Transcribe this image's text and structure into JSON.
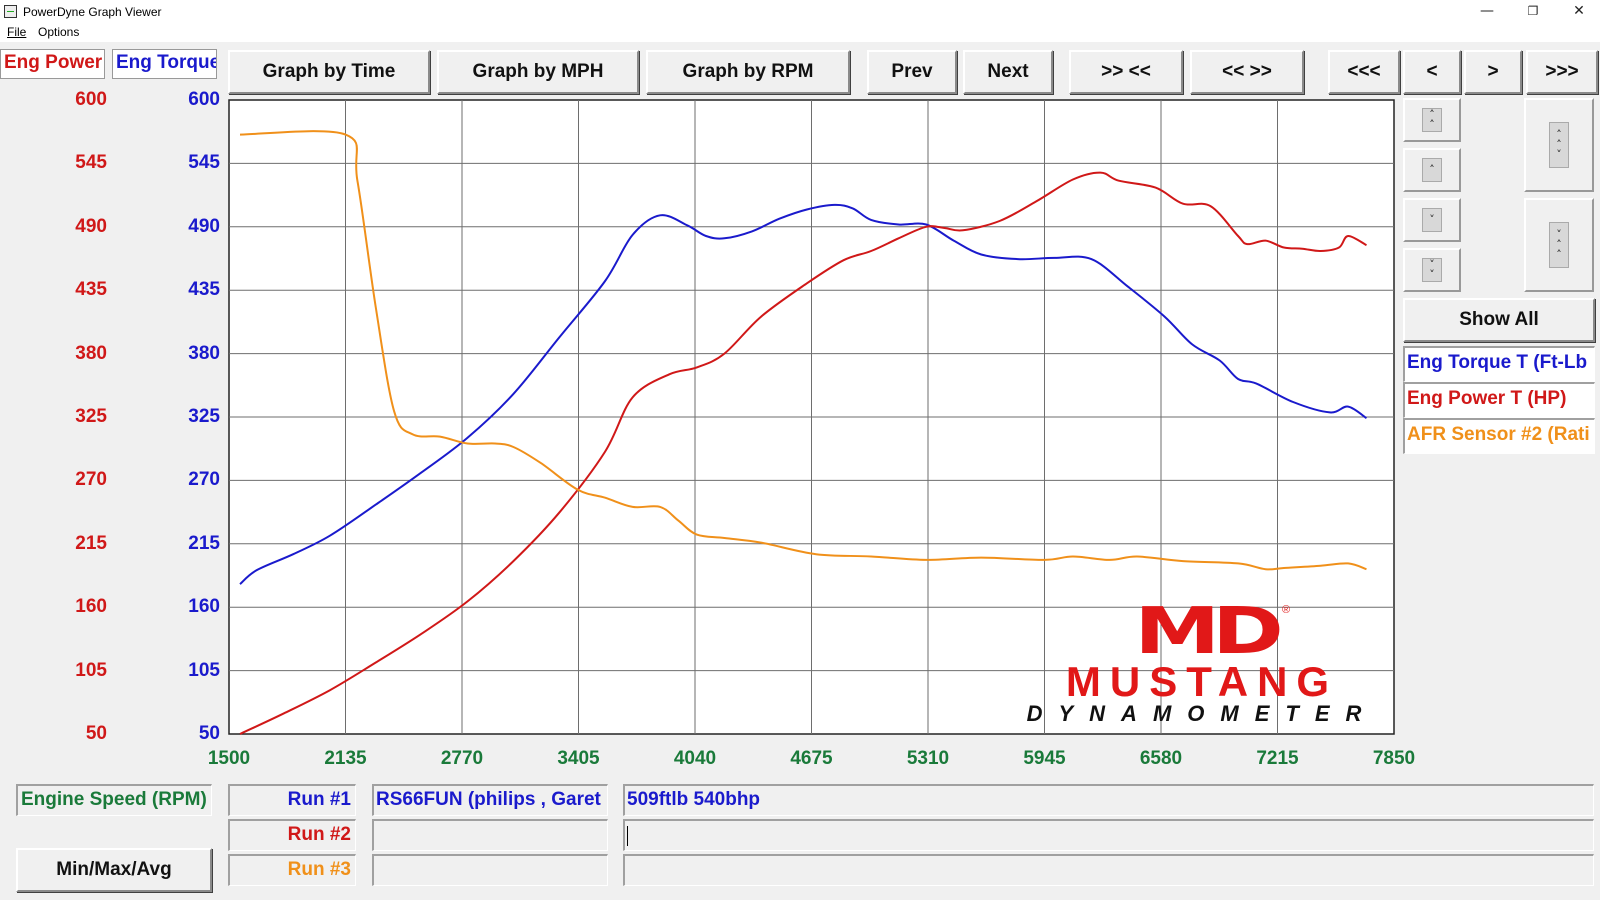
{
  "window": {
    "title": "PowerDyne Graph Viewer",
    "menu": [
      "File",
      "Options"
    ]
  },
  "toolbar": {
    "graph_by_time": "Graph by Time",
    "graph_by_mph": "Graph by MPH",
    "graph_by_rpm": "Graph by RPM",
    "prev": "Prev",
    "next": "Next",
    "zoom_in": ">> <<",
    "zoom_out": "<< >>",
    "first": "<<<",
    "back": "<",
    "forward": ">",
    "last": ">>>"
  },
  "axes": {
    "left1_label": "Eng Power",
    "left2_label": "Eng Torque",
    "x_label": "Engine Speed (RPM)"
  },
  "side": {
    "show_all": "Show All",
    "legend": [
      {
        "label": "Eng Torque T (Ft-Lb",
        "color": "#1a1acc"
      },
      {
        "label": "Eng Power T (HP)",
        "color": "#d01818"
      },
      {
        "label": "AFR Sensor #2 (Rati",
        "color": "#f0901a"
      }
    ]
  },
  "bottom": {
    "min_max_avg": "Min/Max/Avg",
    "runs": [
      {
        "label": "Run #1",
        "color": "#1a1acc",
        "name": "RS66FUN  (philips , Garet",
        "note": "509ftlb 540bhp"
      },
      {
        "label": "Run #2",
        "color": "#d01818",
        "name": "",
        "note": ""
      },
      {
        "label": "Run #3",
        "color": "#f0901a",
        "name": "",
        "note": ""
      }
    ]
  },
  "logo": {
    "mark": "MD",
    "line1": "MUSTANG",
    "line2": "DYNAMOMETER",
    "registered": "®"
  },
  "chart_data": {
    "type": "line",
    "xlabel": "Engine Speed (RPM)",
    "x_ticks": [
      1500,
      2135,
      2770,
      3405,
      4040,
      4675,
      5310,
      5945,
      6580,
      7215,
      7850
    ],
    "y_ticks": [
      600,
      545,
      490,
      435,
      380,
      325,
      270,
      215,
      160,
      105,
      50
    ],
    "xlim": [
      1500,
      7850
    ],
    "ylim": [
      50,
      600
    ],
    "grid": true,
    "series": [
      {
        "name": "Eng Torque T (Ft-Lb",
        "color": "#1a1acc",
        "x": [
          1560,
          1650,
          1850,
          2050,
          2300,
          2550,
          2800,
          3050,
          3300,
          3550,
          3700,
          3850,
          4000,
          4100,
          4200,
          4350,
          4500,
          4650,
          4800,
          4900,
          5000,
          5150,
          5300,
          5450,
          5600,
          5800,
          6000,
          6200,
          6400,
          6600,
          6750,
          6900,
          7000,
          7100,
          7300,
          7500,
          7600,
          7700
        ],
        "y": [
          180,
          192,
          206,
          222,
          249,
          277,
          307,
          345,
          394,
          443,
          483,
          500,
          491,
          482,
          480,
          486,
          497,
          505,
          509,
          506,
          496,
          492,
          492,
          478,
          466,
          462,
          463,
          462,
          438,
          412,
          388,
          374,
          358,
          354,
          338,
          329,
          334,
          324
        ],
        "interpretation": "Values sampled from the plotted torque curve"
      },
      {
        "name": "Eng Power T (HP)",
        "color": "#d01818",
        "x": [
          1560,
          1800,
          2050,
          2300,
          2550,
          2800,
          3050,
          3300,
          3550,
          3700,
          3900,
          4050,
          4200,
          4400,
          4650,
          4850,
          5000,
          5150,
          5300,
          5400,
          5500,
          5700,
          5900,
          6100,
          6250,
          6350,
          6550,
          6700,
          6850,
          7000,
          7050,
          7150,
          7250,
          7350,
          7450,
          7550,
          7600,
          7700
        ],
        "y": [
          50,
          68,
          88,
          112,
          137,
          165,
          200,
          242,
          295,
          342,
          362,
          368,
          380,
          412,
          441,
          461,
          469,
          480,
          490,
          489,
          487,
          495,
          512,
          531,
          537,
          530,
          524,
          510,
          508,
          482,
          475,
          478,
          472,
          471,
          469,
          472,
          482,
          474
        ],
        "interpretation": "Values sampled from the plotted power curve"
      },
      {
        "name": "AFR Sensor #2 (Rati",
        "color": "#f0901a",
        "x": [
          1560,
          2135,
          2200,
          2300,
          2400,
          2500,
          2650,
          2800,
          2950,
          3050,
          3200,
          3400,
          3550,
          3700,
          3850,
          3950,
          4050,
          4200,
          4400,
          4700,
          5000,
          5300,
          5600,
          5945,
          6100,
          6300,
          6450,
          6700,
          7000,
          7150,
          7250,
          7450,
          7600,
          7700
        ],
        "y": [
          570,
          570,
          530,
          420,
          330,
          310,
          308,
          302,
          302,
          299,
          285,
          262,
          255,
          247,
          247,
          235,
          223,
          220,
          216,
          206,
          204,
          201,
          203,
          201,
          204,
          201,
          204,
          200,
          198,
          193,
          194,
          196,
          198,
          193
        ],
        "interpretation": "Values sampled from the plotted AFR curve on the shared graph scale"
      }
    ]
  }
}
